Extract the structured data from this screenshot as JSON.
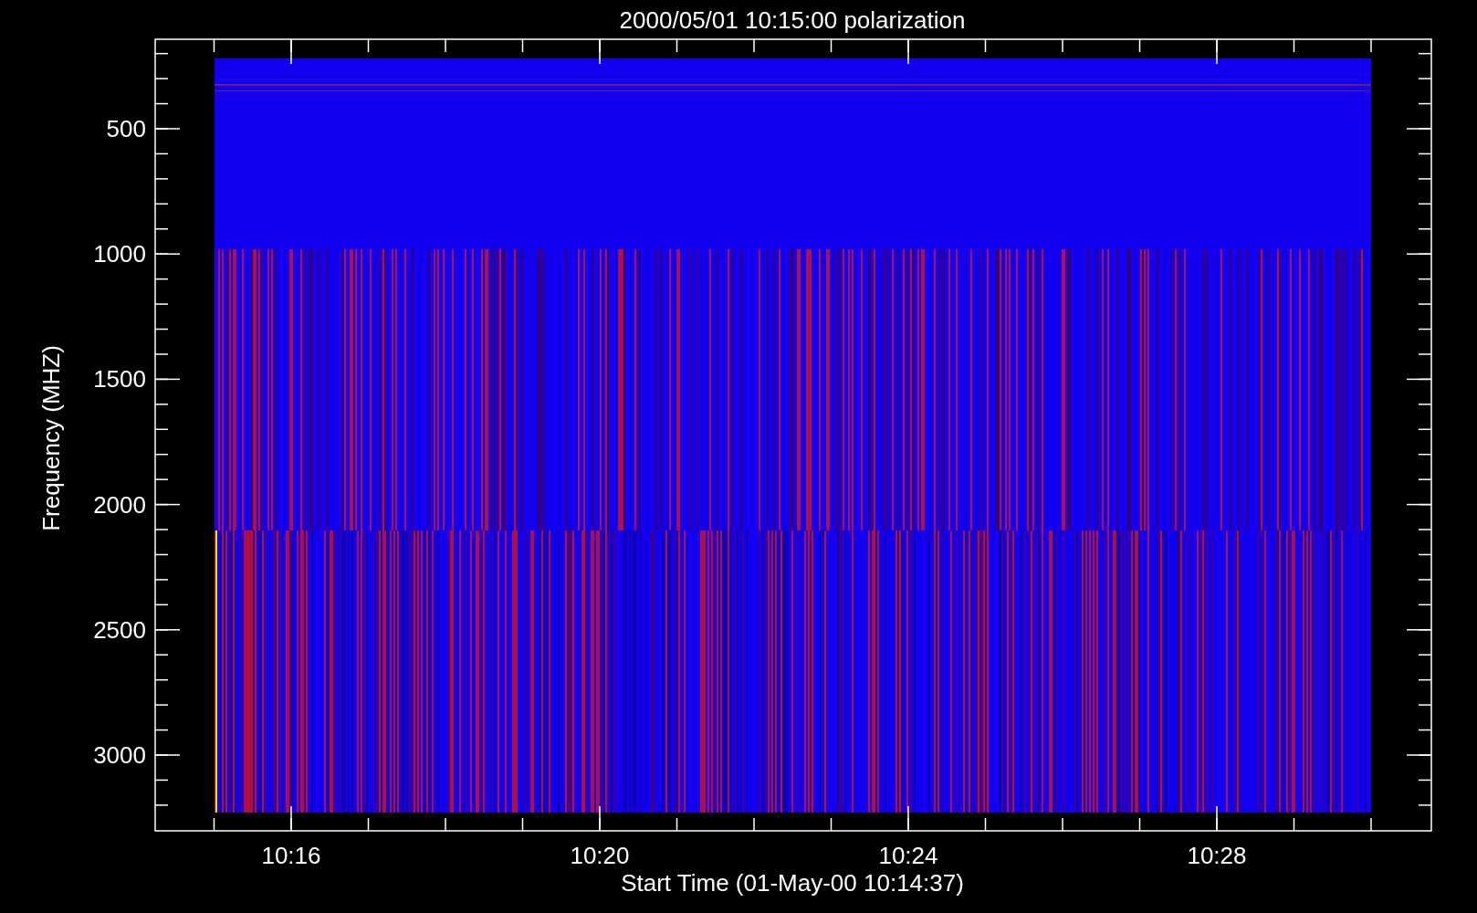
{
  "title": "2000/05/01 10:15:00 polarization",
  "y_axis": {
    "label": "Frequency (MHZ)",
    "ticks": [
      "500",
      "1000",
      "1500",
      "2000",
      "2500",
      "3000"
    ]
  },
  "x_axis": {
    "label": "Start Time (01-May-00 10:14:37)",
    "ticks": [
      "10:16",
      "10:20",
      "10:24",
      "10:28"
    ]
  }
}
